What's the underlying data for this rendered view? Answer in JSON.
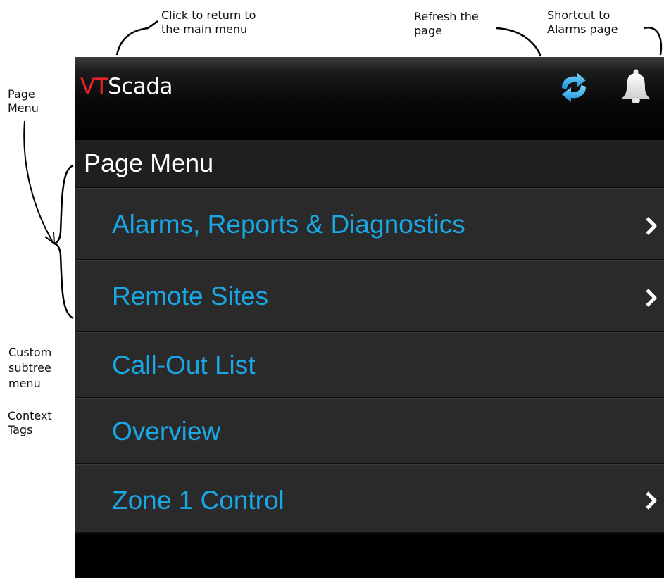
{
  "annotations": {
    "return_main_menu": [
      "Click to return to",
      "the main menu"
    ],
    "refresh": [
      "Refresh the",
      "page"
    ],
    "alarms_shortcut": [
      "Shortcut to",
      "Alarms page"
    ],
    "page_menu": [
      "Page",
      "Menu"
    ],
    "custom_subtree": [
      "Custom",
      "subtree",
      "menu"
    ],
    "context_tags": [
      "Context",
      "Tags"
    ]
  },
  "header": {
    "logo_vt": "VT",
    "logo_scada": "Scada",
    "refresh_icon": "refresh-icon",
    "alarm_icon": "bell-icon"
  },
  "page_menu": {
    "title": "Page Menu",
    "items": [
      {
        "label": "Alarms, Reports & Diagnostics",
        "has_submenu": true
      },
      {
        "label": "Remote Sites",
        "has_submenu": true
      },
      {
        "label": "Call-Out List",
        "has_submenu": false
      },
      {
        "label": "Overview",
        "has_submenu": false
      },
      {
        "label": "Zone 1 Control",
        "has_submenu": true
      }
    ]
  },
  "colors": {
    "accent_blue": "#1aa7e6",
    "logo_red": "#e8262a",
    "item_bg": "#2a2a2a"
  }
}
